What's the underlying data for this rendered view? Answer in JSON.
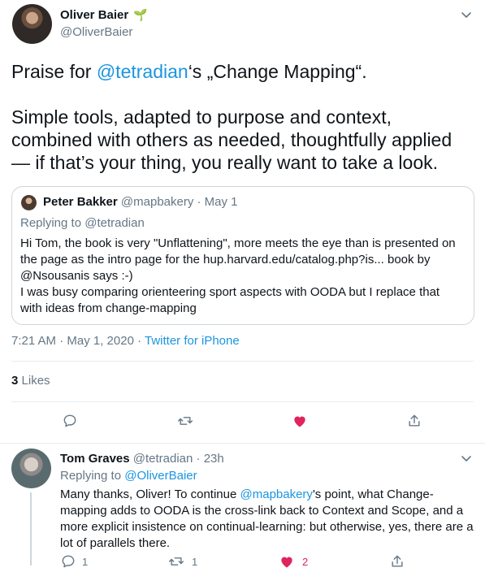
{
  "main_tweet": {
    "author_name": "Oliver Baier",
    "author_emoji": "🌱",
    "author_handle": "@OliverBaier",
    "text_part1": "Praise for ",
    "text_mention": "@tetradian",
    "text_part2": "‘s „Change Mapping“.",
    "text_paragraph2": "Simple tools, adapted to purpose and context, combined with others as needed, thoughtfully applied — if that’s your thing, you really want to take a look.",
    "timestamp": "7:21 AM · May 1, 2020",
    "separator": " · ",
    "source": "Twitter for iPhone",
    "likes_count": "3",
    "likes_label": "Likes"
  },
  "quoted_tweet": {
    "author_name": "Peter Bakker",
    "author_handle": "@mapbakery",
    "date": "· May 1",
    "replying_to": "Replying to @tetradian",
    "body": "Hi Tom, the book is very \"Unflattening\", more meets the eye than is presented on the page as the intro page for the hup.harvard.edu/catalog.php?is... book by @Nsousanis says :-)\nI was busy comparing orienteering sport aspects with OODA but I replace that with ideas from change-mapping"
  },
  "reply_tweet": {
    "author_name": "Tom Graves",
    "author_handle": "@tetradian",
    "time": "· 23h",
    "replying_prefix": "Replying to ",
    "replying_handle": "@OliverBaier",
    "body_part1": "Many thanks, Oliver! To continue ",
    "body_mention": "@mapbakery",
    "body_part2": "'s point, what Change-mapping adds to OODA is the cross-link back to Context and Scope, and a more explicit insistence on continual-learning: but otherwise, yes, there are a lot of parallels there.",
    "reply_count": "1",
    "retweet_count": "1",
    "like_count": "2"
  },
  "icons": {
    "reply": "comment-icon",
    "retweet": "retweet-icon",
    "like": "heart-icon",
    "share": "share-icon",
    "more": "chevron-down-icon"
  },
  "colors": {
    "link": "#1b95e0",
    "like_active": "#e0245e",
    "secondary_text": "#657786",
    "border": "#e6ecf0"
  }
}
